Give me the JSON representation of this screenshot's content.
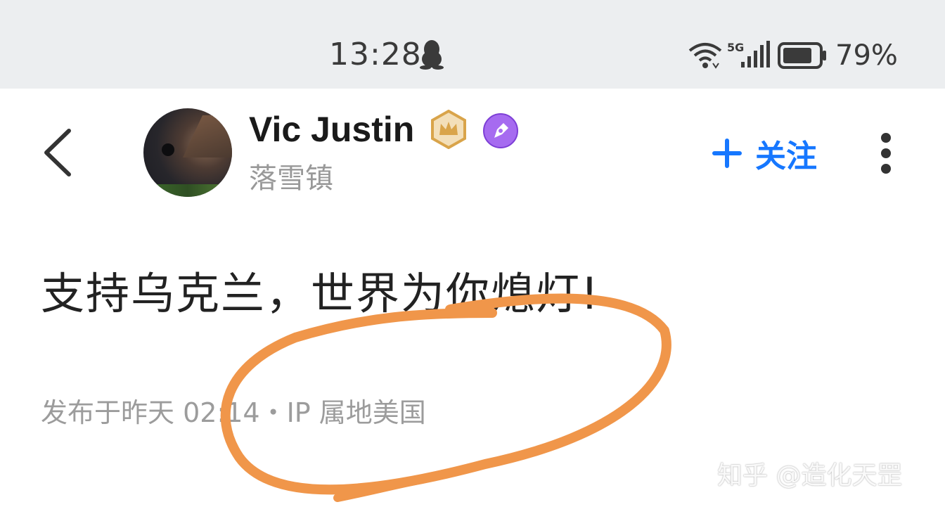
{
  "status_bar": {
    "time": "13:28",
    "network": "5G",
    "battery": "79%"
  },
  "profile": {
    "name": "Vic Justin",
    "subtitle": "落雪镇"
  },
  "header": {
    "follow_label": "关注"
  },
  "post": {
    "text": "支持乌克兰，世界为你熄灯!",
    "meta": "发布于昨天 02:14・IP 属地美国"
  },
  "watermark": "知乎 @造化天罡",
  "colors": {
    "accent": "#1677ff",
    "annotation": "#f0964a",
    "status_bar_bg": "#eceef0",
    "badge_purple": "#a66bf0",
    "badge_gold": "#d9a44a"
  },
  "icons": [
    "back-icon",
    "qq-penguin-icon",
    "wifi-icon",
    "signal-icon",
    "battery-icon",
    "crown-badge-icon",
    "pen-badge-icon",
    "plus-icon",
    "more-icon"
  ]
}
